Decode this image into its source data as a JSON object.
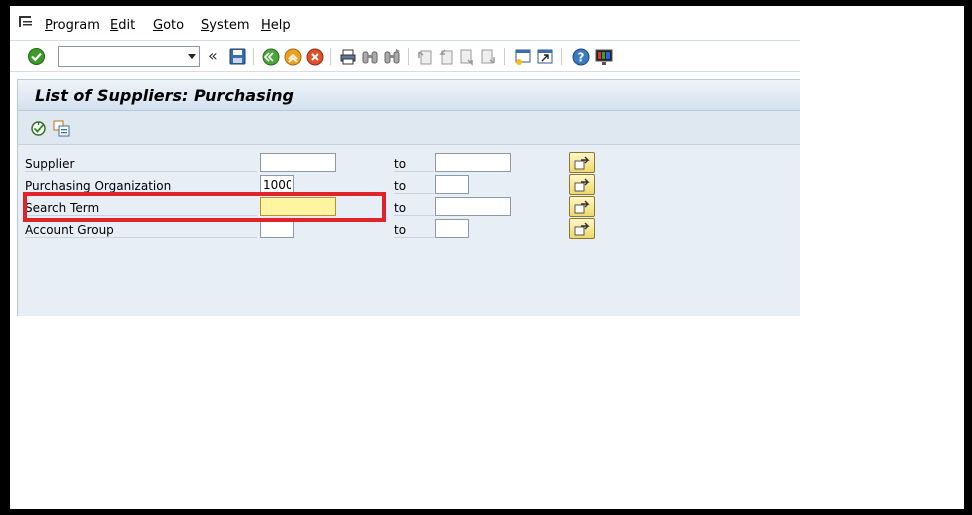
{
  "menu": {
    "items": [
      {
        "label": "Program",
        "first": "P",
        "rest": "rogram"
      },
      {
        "label": "Edit",
        "first": "E",
        "rest": "dit"
      },
      {
        "label": "Goto",
        "first": "G",
        "rest": "oto"
      },
      {
        "label": "System",
        "first": "S",
        "rest": "ystem"
      },
      {
        "label": "Help",
        "first": "H",
        "rest": "elp"
      }
    ]
  },
  "toolbar": {
    "command_value": "",
    "collapse_glyph": "«",
    "icons": [
      "enter-icon",
      "save-icon",
      "back-icon",
      "exit-icon",
      "cancel-icon",
      "print-icon",
      "find-icon",
      "find-next-icon",
      "first-page-icon",
      "previous-page-icon",
      "next-page-icon",
      "last-page-icon",
      "create-session-icon",
      "shortcut-icon",
      "help-icon",
      "customize-layout-icon"
    ]
  },
  "title": "List of Suppliers: Purchasing",
  "app_toolbar": {
    "icons": [
      "execute-icon",
      "get-variant-icon"
    ]
  },
  "selection": {
    "rows": [
      {
        "label": "Supplier",
        "from": "",
        "to_label": "to",
        "to": ""
      },
      {
        "label": "Purchasing Organization",
        "from": "1000",
        "to_label": "to",
        "to": ""
      },
      {
        "label": "Search Term",
        "from": "",
        "to_label": "to",
        "to": ""
      },
      {
        "label": "Account Group",
        "from": "",
        "to_label": "to",
        "to": ""
      }
    ]
  },
  "colors": {
    "highlight": "#e0242a",
    "focused_field": "#fff5a0",
    "title_bar": "#d3e1ee",
    "content_bg": "#e7eef5"
  }
}
